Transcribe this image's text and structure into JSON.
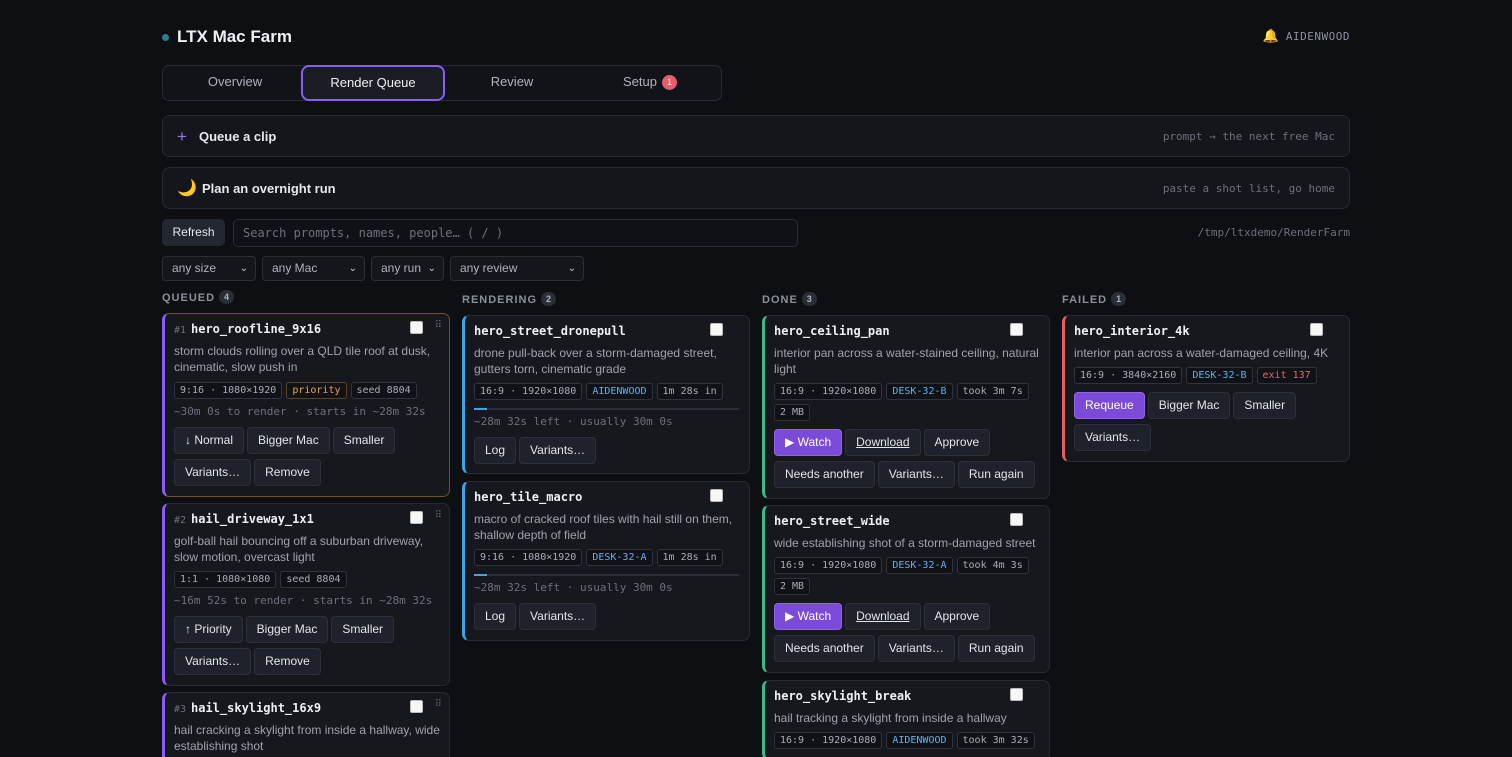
{
  "app": {
    "title": "LTX Mac Farm",
    "user": "AIDENWOOD",
    "bell_icon": "bell-icon"
  },
  "tabs": [
    {
      "label": "Overview"
    },
    {
      "label": "Render Queue",
      "active": true
    },
    {
      "label": "Review"
    },
    {
      "label": "Setup",
      "badge": "1"
    }
  ],
  "queue_bar": {
    "icon": "+",
    "label": "Queue a clip",
    "hint": "prompt → the next free Mac"
  },
  "overnight_bar": {
    "icon": "🌙",
    "label": "Plan an overnight run",
    "hint": "paste a shot list, go home"
  },
  "toolbar": {
    "refresh_label": "Refresh",
    "search_placeholder": "Search prompts, names, people…  ( / )",
    "path": "/tmp/ltxdemo/RenderFarm"
  },
  "filters": [
    "any size",
    "any Mac",
    "any run",
    "any review"
  ],
  "columns": {
    "queued": {
      "title": "QUEUED",
      "count": "4",
      "cards": [
        {
          "num": "#1",
          "name": "hero_roofline_9x16",
          "desc": "storm clouds rolling over a QLD tile roof at dusk, cinematic, slow push in",
          "chips": [
            "9:16 · 1080×1920",
            "priority",
            "seed 8804"
          ],
          "eta": "~30m 0s to render · starts in ~28m 32s",
          "buttons": [
            "↓ Normal",
            "Bigger Mac",
            "Smaller",
            "Variants…",
            "Remove"
          ]
        },
        {
          "num": "#2",
          "name": "hail_driveway_1x1",
          "desc": "golf-ball hail bouncing off a suburban driveway, slow motion, overcast light",
          "chips": [
            "1:1 · 1080×1080",
            "seed 8804"
          ],
          "eta": "~16m 52s to render · starts in ~28m 32s",
          "buttons": [
            "↑ Priority",
            "Bigger Mac",
            "Smaller",
            "Variants…",
            "Remove"
          ]
        },
        {
          "num": "#3",
          "name": "hail_skylight_16x9",
          "desc": "hail cracking a skylight from inside a hallway, wide establishing shot"
        }
      ]
    },
    "rendering": {
      "title": "RENDERING",
      "count": "2",
      "cards": [
        {
          "name": "hero_street_dronepull",
          "desc": "drone pull-back over a storm-damaged street, gutters torn, cinematic grade",
          "chips": [
            "16:9 · 1920×1080",
            "AIDENWOOD",
            "1m 28s in"
          ],
          "progress": 0.05,
          "eta": "~28m 32s left · usually 30m 0s",
          "buttons": [
            "Log",
            "Variants…"
          ]
        },
        {
          "name": "hero_tile_macro",
          "desc": "macro of cracked roof tiles with hail still on them, shallow depth of field",
          "chips": [
            "9:16 · 1080×1920",
            "DESK-32-A",
            "1m 28s in"
          ],
          "progress": 0.05,
          "eta": "~28m 32s left · usually 30m 0s",
          "buttons": [
            "Log",
            "Variants…"
          ]
        }
      ]
    },
    "done": {
      "title": "DONE",
      "count": "3",
      "cards": [
        {
          "name": "hero_ceiling_pan",
          "desc": "interior pan across a water-stained ceiling, natural light",
          "chips": [
            "16:9 · 1920×1080",
            "DESK-32-B",
            "took 3m 7s",
            "2 MB"
          ],
          "buttons": [
            "▶ Watch",
            "Download",
            "Approve",
            "Needs another",
            "Variants…",
            "Run again"
          ]
        },
        {
          "name": "hero_street_wide",
          "desc": "wide establishing shot of a storm-damaged street",
          "chips": [
            "16:9 · 1920×1080",
            "DESK-32-A",
            "took 4m 3s",
            "2 MB"
          ],
          "buttons": [
            "▶ Watch",
            "Download",
            "Approve",
            "Needs another",
            "Variants…",
            "Run again"
          ]
        },
        {
          "name": "hero_skylight_break",
          "desc": "hail tracking a skylight from inside a hallway",
          "chips": [
            "16:9 · 1920×1080",
            "AIDENWOOD",
            "took 3m 32s"
          ]
        }
      ]
    },
    "failed": {
      "title": "FAILED",
      "count": "1",
      "cards": [
        {
          "name": "hero_interior_4k",
          "desc": "interior pan across a water-damaged ceiling, 4K",
          "chips": [
            "16:9 · 3840×2160",
            "DESK-32-B",
            "exit 137"
          ],
          "buttons": [
            "Requeue",
            "Bigger Mac",
            "Smaller",
            "Variants…"
          ]
        }
      ]
    }
  },
  "colors": {
    "accent": "#8b5cf6",
    "queued": "#8b5cf6",
    "queued_priority": "#8a6a2c",
    "rendering": "#3fa4e6",
    "done": "#3fb98a",
    "failed": "#e35d6a"
  }
}
